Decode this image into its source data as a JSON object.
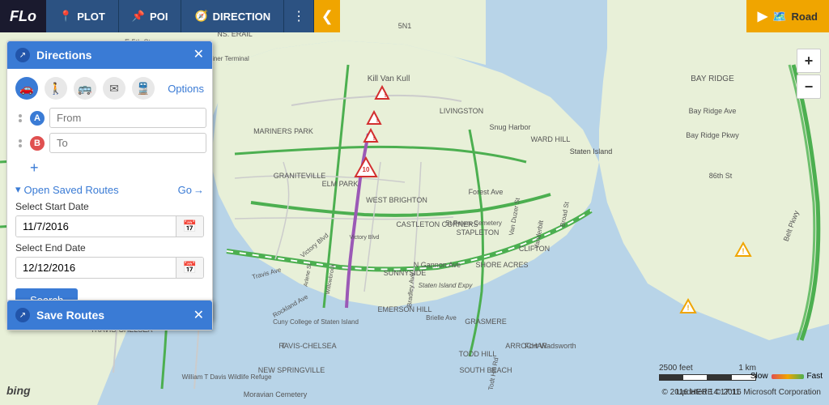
{
  "app": {
    "logo": "FLo",
    "toolbar": {
      "plot_label": "PLOT",
      "poi_label": "POI",
      "direction_label": "DIRECTION",
      "more_icon": "⋮",
      "collapse_arrow": "❮",
      "road_label": "Road"
    }
  },
  "directions_panel": {
    "title": "Directions",
    "close_icon": "✕",
    "transport_modes": [
      {
        "id": "car",
        "icon": "🚗",
        "active": true
      },
      {
        "id": "walk",
        "icon": "🚶",
        "active": false
      },
      {
        "id": "transit",
        "icon": "🚌",
        "active": false
      },
      {
        "id": "email",
        "icon": "✉",
        "active": false
      },
      {
        "id": "train",
        "icon": "🚆",
        "active": false
      }
    ],
    "options_label": "Options",
    "from_placeholder": "From",
    "to_placeholder": "To",
    "add_waypoint_icon": "+",
    "open_saved_routes": "Open Saved Routes",
    "go_label": "Go",
    "go_arrow": "→",
    "select_start_date": "Select Start Date",
    "start_date_value": "11/7/2016",
    "start_date_placeholder": "11/7/2016",
    "select_end_date": "Select End Date",
    "end_date_value": "12/12/2016",
    "end_date_placeholder": "12/12/2016",
    "calendar_icon": "📅",
    "search_label": "Search"
  },
  "save_routes_panel": {
    "title": "Save Routes",
    "close_icon": "✕"
  },
  "zoom_controls": {
    "plus": "+",
    "minus": "−"
  },
  "scale": {
    "label1": "2500 feet",
    "label2": "1 km"
  },
  "copyright": "© 2016 HERE  © 2016 Microsoft Corporation",
  "speed_legend": {
    "slow_label": "Slow",
    "fast_label": "Fast",
    "slow_color": "#e05050",
    "fast_color": "#4caf50"
  },
  "timestamp": {
    "label": "Updated 14:17:11"
  },
  "bing": {
    "label": "bing"
  }
}
